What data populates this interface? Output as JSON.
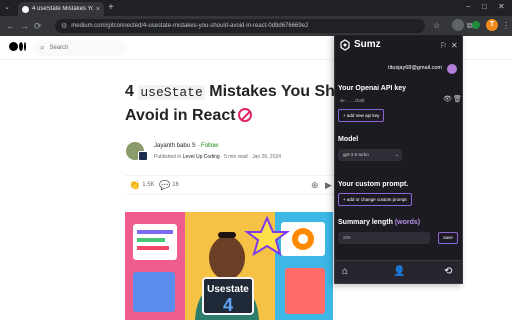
{
  "browser": {
    "tab_title": "4 useState Mistakes You Shou...",
    "tab_close": "×",
    "new_tab": "+",
    "tab_list": "⌄",
    "window_controls": [
      "−",
      "□",
      "✕"
    ],
    "url": "medium.com/gitconnected/4-usestate-mistakes-you-should-avoid-in-react-0d9d676669e2",
    "nav": {
      "back": "←",
      "forward": "→",
      "reload": "⟳"
    },
    "toolbar_icons": {
      "star": "☆",
      "puzzle": "⧉",
      "ext_active": "",
      "side_panel": "▯",
      "menu": "⋮"
    },
    "profile_initial": "T"
  },
  "medium": {
    "search_placeholder": "Search",
    "search_icon": "⌕"
  },
  "article": {
    "title_number": "4",
    "title_code": "useState",
    "title_rest_line1": "Mistakes You Shou",
    "title_line2": "Avoid in React",
    "author": "Jayanth babu S",
    "separator": "·",
    "follow": "Follow",
    "published_in": "Published in",
    "publication": "Level Up Coding",
    "read_time": "5 min read",
    "date": "Jan 26, 2024",
    "claps": "1.5K",
    "responses": "16",
    "clap_icon": "👏",
    "comment_icon": "💬",
    "bookmark_icon": "⊕",
    "play_icon": "▶",
    "hero_text": "Usestate",
    "hero_number": "4"
  },
  "extension": {
    "name": "Sumz",
    "email": "titusjay68@gmail.com",
    "flag_icon": "⚐",
    "close_icon": "✕",
    "api_key_label": "Your Openai API key",
    "api_key_value": "sk-... ...chaft",
    "eye_icon": "👁",
    "trash_icon": "🗑",
    "add_key_button": "+ add new api key",
    "model_label": "Model",
    "model_value": "gpt-3.5-turbo",
    "chevron": "⌄",
    "prompt_label": "Your custom prompt.",
    "prompt_button": "+ add or change custom prompt",
    "summary_label": "Summary length",
    "summary_unit": "(words)",
    "summary_value": "200",
    "save_button": "save",
    "nav_home": "⌂",
    "nav_profile": "👤",
    "nav_history": "⟲",
    "accent": "#8a66d8",
    "unit_color": "#b48ee8"
  }
}
